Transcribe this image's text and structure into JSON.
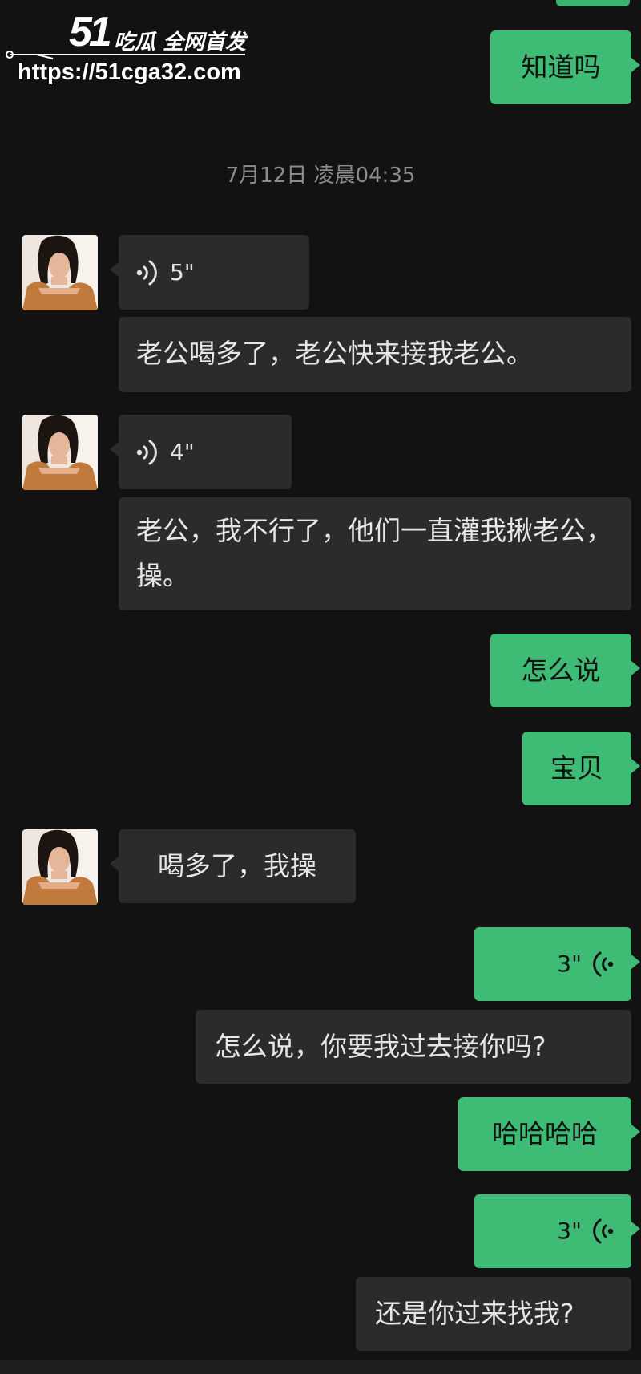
{
  "watermark": {
    "logo": "51",
    "tagline": "吃瓜 全网首发",
    "url": "https://51cga32.com"
  },
  "chat": {
    "timestamp": "7月12日 凌晨04:35",
    "messages": [
      {
        "side": "out",
        "kind": "text",
        "text": "知道吗"
      },
      {
        "side": "in",
        "kind": "voice",
        "duration": "5\""
      },
      {
        "side": "in",
        "kind": "text",
        "text": "老公喝多了，老公快来接我老公。"
      },
      {
        "side": "in",
        "kind": "voice",
        "duration": "4\""
      },
      {
        "side": "in",
        "kind": "text",
        "text": "老公，我不行了，他们一直灌我揪老公，操。"
      },
      {
        "side": "out",
        "kind": "text",
        "text": "怎么说"
      },
      {
        "side": "out",
        "kind": "text",
        "text": "宝贝"
      },
      {
        "side": "in",
        "kind": "text",
        "text": "喝多了，我操"
      },
      {
        "side": "out",
        "kind": "voice",
        "duration": "3\""
      },
      {
        "side": "in",
        "kind": "text",
        "text": "怎么说，你要我过去接你吗?"
      },
      {
        "side": "out",
        "kind": "text",
        "text": "哈哈哈哈"
      },
      {
        "side": "out",
        "kind": "voice",
        "duration": "3\""
      },
      {
        "side": "in",
        "kind": "text",
        "text": "还是你过来找我?"
      }
    ]
  },
  "colors": {
    "background": "#121212",
    "outgoing_bubble": "#3ebb75",
    "incoming_bubble": "#2b2b2b",
    "incoming_text": "#e6e6e6",
    "timestamp_text": "#8c8c8c"
  }
}
